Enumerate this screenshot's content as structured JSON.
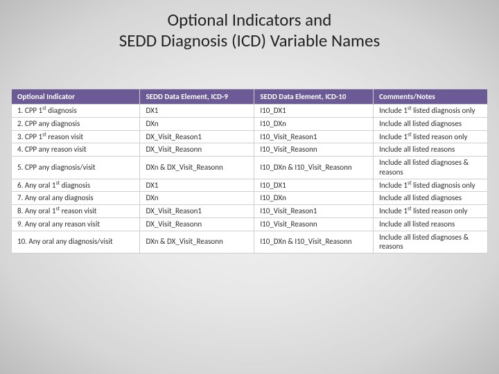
{
  "title_line1": "Optional Indicators and",
  "title_line2": "SEDD Diagnosis (ICD) Variable Names",
  "table": {
    "headers": {
      "optional_indicator": "Optional Indicator",
      "icd9": "SEDD Data Element, ICD-9",
      "icd10": "SEDD Data Element, ICD-10",
      "notes": "Comments/Notes"
    },
    "rows": [
      {
        "indicator": "1. CPP 1<sup>st</sup> diagnosis",
        "icd9": "DX1",
        "icd10": "I10_DX1",
        "notes": "Include 1<sup>st</sup> listed diagnosis only"
      },
      {
        "indicator": "2. CPP any diagnosis",
        "icd9": "DXn",
        "icd10": "I10_DXn",
        "notes": "Include all listed diagnoses"
      },
      {
        "indicator": "3. CPP 1<sup>st</sup> reason visit",
        "icd9": "DX_Visit_Reason1",
        "icd10": "I10_Visit_Reason1",
        "notes": "Include 1<sup>st</sup> listed reason only"
      },
      {
        "indicator": "4. CPP any reason visit",
        "icd9": "DX_Visit_Reasonn",
        "icd10": "I10_Visit_Reasonn",
        "notes": "Include all listed reasons"
      },
      {
        "indicator": "5. CPP any diagnosis/visit",
        "icd9": "DXn & DX_Visit_Reasonn",
        "icd10": "I10_DXn & I10_Visit_Reasonn",
        "notes": "Include all listed diagnoses & reasons"
      },
      {
        "indicator": "6. Any oral 1<sup>st</sup> diagnosis",
        "icd9": "DX1",
        "icd10": "I10_DX1",
        "notes": "Include 1<sup>st</sup> listed diagnosis only"
      },
      {
        "indicator": "7. Any oral any diagnosis",
        "icd9": "DXn",
        "icd10": "I10_DXn",
        "notes": "Include all listed diagnoses"
      },
      {
        "indicator": "8. Any oral 1<sup>st</sup> reason visit",
        "icd9": "DX_Visit_Reason1",
        "icd10": "I10_Visit_Reason1",
        "notes": "Include 1<sup>st</sup> listed reason only"
      },
      {
        "indicator": "9. Any oral any reason visit",
        "icd9": "DX_Visit_Reasonn",
        "icd10": "I10_Visit_Reasonn",
        "notes": "Include all listed reasons"
      },
      {
        "indicator": "10. Any oral any diagnosis/visit",
        "icd9": "DXn & DX_Visit_Reasonn",
        "icd10": "I10_DXn & I10_Visit_Reasonn",
        "notes": "Include all listed diagnoses & reasons"
      }
    ]
  }
}
